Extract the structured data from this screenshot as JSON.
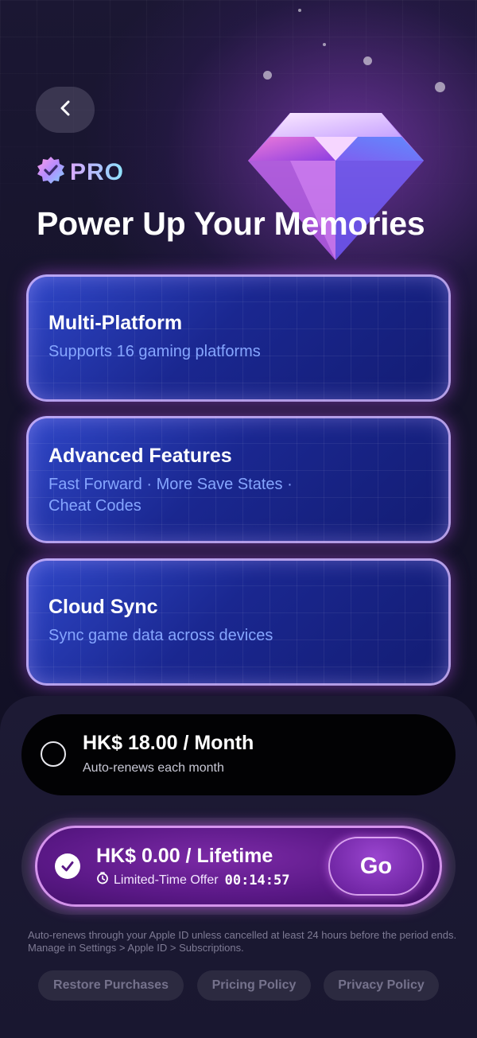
{
  "header": {
    "badge_label": "PRO",
    "headline": "Power Up Your Memories"
  },
  "features": [
    {
      "title": "Multi-Platform",
      "subtitle_lines": [
        "Supports 16 gaming platforms"
      ]
    },
    {
      "title": "Advanced Features",
      "subtitle_lines": [
        "Fast Forward · More Save States ·",
        "Cheat Codes"
      ]
    },
    {
      "title": "Cloud Sync",
      "subtitle_lines": [
        "Sync game data across devices"
      ]
    }
  ],
  "plans": {
    "monthly": {
      "price": "HK$ 18.00 / Month",
      "note": "Auto-renews each month",
      "selected": false
    },
    "lifetime": {
      "price": "HK$ 0.00 / Lifetime",
      "offer_label": "Limited-Time Offer",
      "timer": "00:14:57",
      "selected": true,
      "go_label": "Go"
    }
  },
  "legal_text": "Auto-renews through your Apple ID unless cancelled at least 24 hours before the period ends. Manage in Settings > Apple ID > Subscriptions.",
  "footer": {
    "restore": "Restore Purchases",
    "pricing": "Pricing Policy",
    "privacy": "Privacy Policy"
  },
  "icons": {
    "back": "chevron-left-icon",
    "badge": "verified-check-icon",
    "gem": "diamond-icon",
    "check": "checkmark-icon",
    "timer": "clock-icon"
  },
  "colors": {
    "accent_purple": "#7b2aa6",
    "card_blue": "#1a2790",
    "subtitle_blue": "#86a6ff",
    "background": "#15132a"
  }
}
